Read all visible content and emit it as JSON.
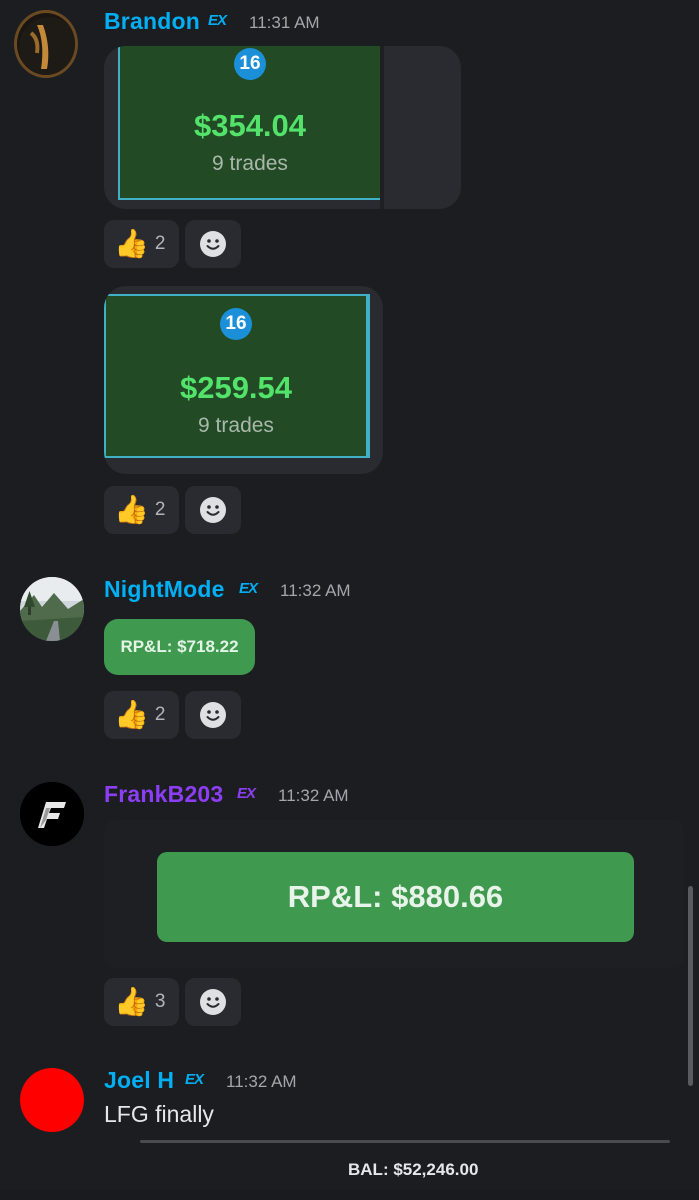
{
  "messages": [
    {
      "username": "Brandon",
      "username_color": "#00aff4",
      "badge": "EX",
      "time": "11:31 AM",
      "cards": [
        {
          "number": "16",
          "amount": "$354.04",
          "trades": "9 trades"
        },
        {
          "number": "16",
          "amount": "$259.54",
          "trades": "9 trades"
        }
      ],
      "reactions": [
        {
          "emoji": "👍",
          "count": "2"
        },
        {
          "emoji": "👍",
          "count": "2"
        }
      ]
    },
    {
      "username": "NightMode",
      "username_color": "#00aff4",
      "badge": "EX",
      "time": "11:32 AM",
      "rpl": "RP&L: $718.22",
      "reactions": [
        {
          "emoji": "👍",
          "count": "2"
        }
      ]
    },
    {
      "username": "FrankB203",
      "username_color": "#8c3ef5",
      "badge": "EX",
      "time": "11:32 AM",
      "rpl": "RP&L: $880.66",
      "reactions": [
        {
          "emoji": "👍",
          "count": "3"
        }
      ]
    },
    {
      "username": "Joel H",
      "username_color": "#00aff4",
      "badge": "EX",
      "time": "11:32 AM",
      "text": "LFG finally",
      "partial_text": "BAL: $52,246.00"
    }
  ],
  "colors": {
    "background": "#1c1d21",
    "card_green": "#214a25",
    "card_amount": "#54e36a",
    "pill_green": "#3f9a4f",
    "reaction_bg": "#2a2b31",
    "timestamp": "#a4a6ad"
  },
  "icons": {
    "add_reaction": "smiley-face-icon",
    "badge": "ex-badge-icon"
  }
}
